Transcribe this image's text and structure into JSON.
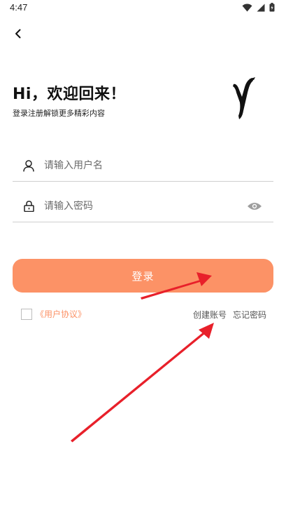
{
  "status_bar": {
    "time": "4:47"
  },
  "header": {
    "back_icon": "chevron-left-icon"
  },
  "welcome": {
    "greeting": "Hi，欢迎回来！",
    "subtitle": "登录注册解锁更多精彩内容"
  },
  "form": {
    "username": {
      "placeholder": "请输入用户名",
      "value": "",
      "icon": "user-icon"
    },
    "password": {
      "placeholder": "请输入密码",
      "value": "",
      "icon": "lock-icon",
      "toggle_icon": "eye-icon"
    },
    "login_label": "登录"
  },
  "agreement": {
    "checked": false,
    "link_label": "《用户协议》"
  },
  "links": {
    "create_account": "创建账号",
    "forgot_password": "忘记密码"
  },
  "colors": {
    "accent": "#fc9266",
    "annotation_arrow": "#e8202a",
    "divider": "#cfcfcf"
  }
}
